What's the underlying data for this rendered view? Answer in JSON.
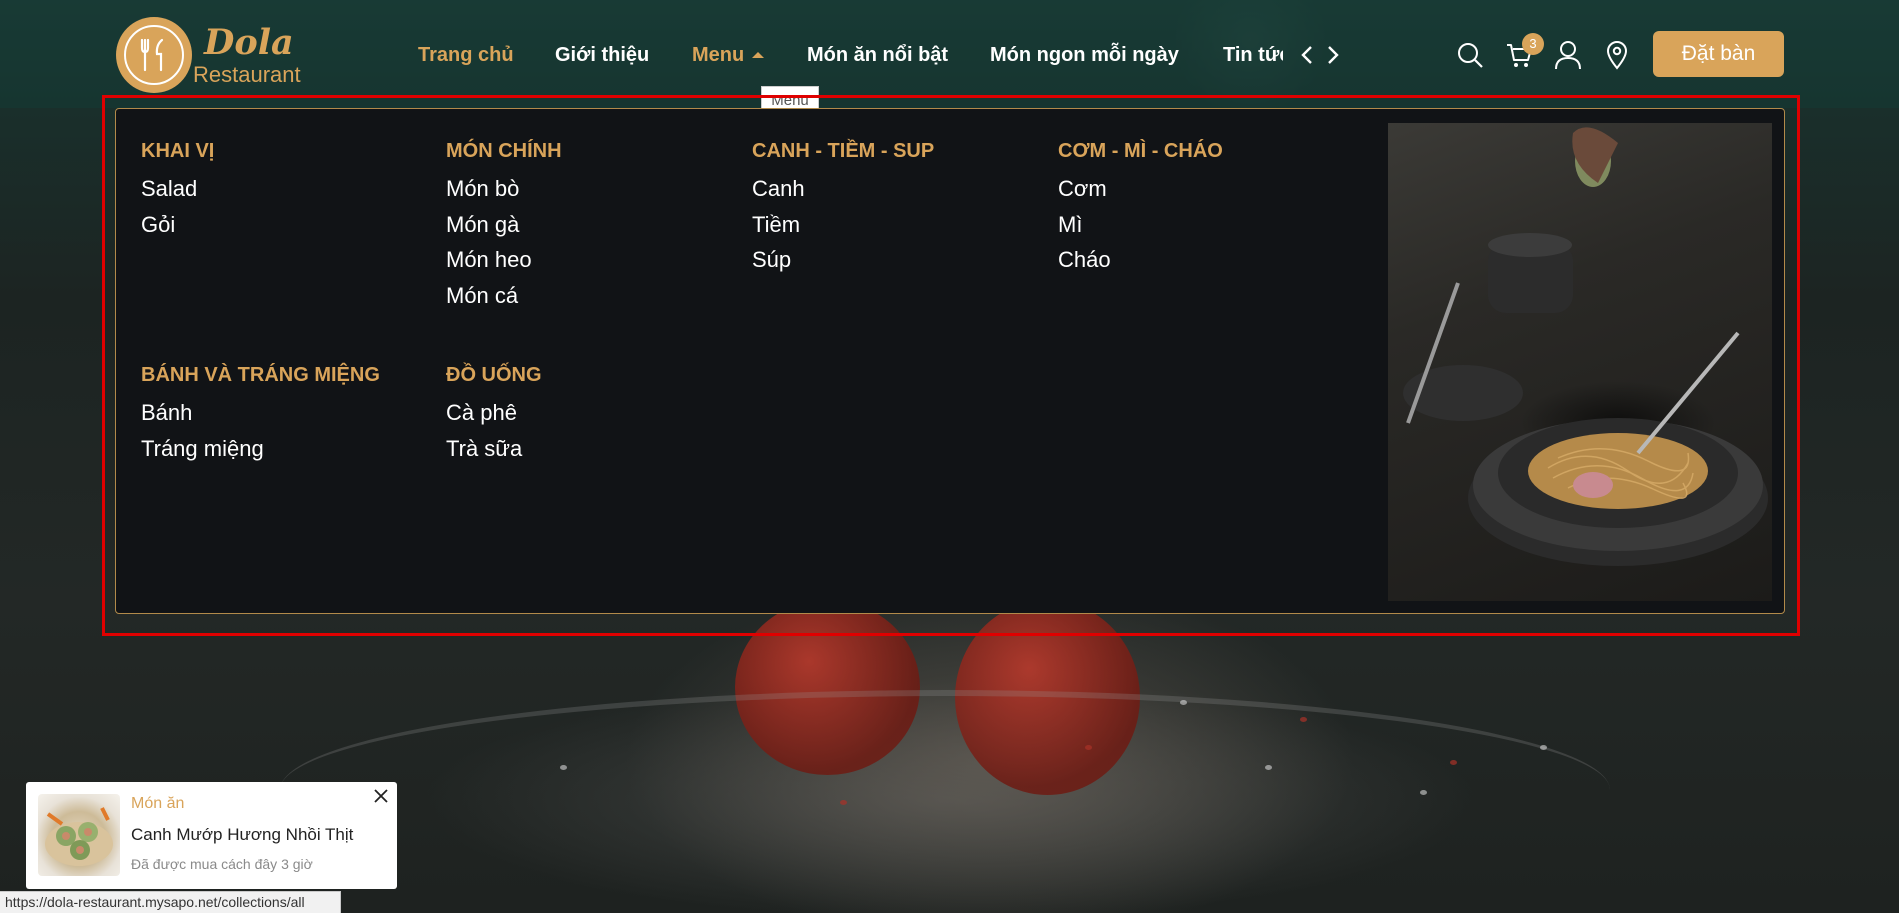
{
  "header": {
    "logo": {
      "brand": "Dola",
      "subtitle": "Restaurant"
    },
    "nav": {
      "items": [
        {
          "label": "Trang chủ",
          "active": true
        },
        {
          "label": "Giới thiệu",
          "active": false
        },
        {
          "label": "Menu",
          "active": true,
          "has_dropdown": true
        },
        {
          "label": "Món ăn nổi bật",
          "active": false
        },
        {
          "label": "Món ngon mỗi ngày",
          "active": false
        },
        {
          "label": "Tin tức",
          "active": false
        }
      ],
      "prev_icon": "chevron-left-icon",
      "next_icon": "chevron-right-icon"
    },
    "icons": {
      "search": "search-icon",
      "cart": "cart-icon",
      "account": "user-icon",
      "location": "location-pin-icon"
    },
    "cart_count": "3",
    "book_button": "Đặt bàn"
  },
  "tooltip": "Menu",
  "mega_menu": {
    "columns": [
      {
        "title": "KHAI VỊ",
        "links": [
          "Salad",
          "Gỏi"
        ]
      },
      {
        "title": "MÓN CHÍNH",
        "links": [
          "Món bò",
          "Món gà",
          "Món heo",
          "Món cá"
        ]
      },
      {
        "title": "CANH - TIỀM - SUP",
        "links": [
          "Canh",
          "Tiềm",
          "Súp"
        ]
      },
      {
        "title": "CƠM - MÌ - CHÁO",
        "links": [
          "Cơm",
          "Mì",
          "Cháo"
        ]
      },
      {
        "title": "BÁNH VÀ TRÁNG MIỆNG",
        "links": [
          "Bánh",
          "Tráng miệng"
        ]
      },
      {
        "title": "ĐỒ UỐNG",
        "links": [
          "Cà phê",
          "Trà sữa"
        ]
      }
    ]
  },
  "notification": {
    "category": "Món ăn",
    "title": "Canh Mướp Hương Nhồi Thịt",
    "time": "Đã được mua cách đây 3 giờ"
  },
  "status_bar": {
    "url": "https://dola-restaurant.mysapo.net/collections/all"
  },
  "colors": {
    "accent": "#d9a45a",
    "menu_bg": "#111316",
    "highlight": "#e00000"
  }
}
